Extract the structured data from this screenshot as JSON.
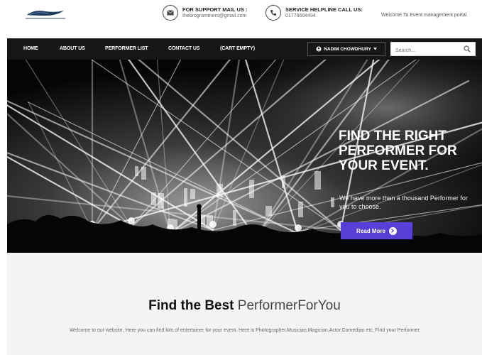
{
  "topbar": {
    "logo_icon": "brand-logo-icon",
    "support": {
      "icon": "mail-icon",
      "title": "FOR SUPPORT MAIL US :",
      "value": "thebrogrammers@gmail.com"
    },
    "helpline": {
      "icon": "phone-icon",
      "title": "SERVICE HELPLINE CALL US:",
      "value": "01776604494"
    },
    "welcome": "Welcome To Event management portal"
  },
  "nav": {
    "items": [
      {
        "label": "HOME"
      },
      {
        "label": "ABOUT US"
      },
      {
        "label": "PERFORMER LIST"
      },
      {
        "label": "CONTACT US"
      },
      {
        "label": "(CART EMPTY)"
      }
    ],
    "user": {
      "icon": "user-circle-icon",
      "label": "NADIM CHOWDHURY",
      "caret_icon": "caret-down-icon"
    },
    "search": {
      "placeholder": "Search...",
      "icon": "search-icon"
    }
  },
  "hero": {
    "title": "FIND THE RIGHT PERFORMER FOR YOUR EVENT.",
    "subtitle": "We have more than a thousand Performer for you to choose.",
    "button_label": "Read More",
    "button_icon": "arrow-right-circle-icon",
    "colors": {
      "button": "#5a3fd6"
    }
  },
  "section": {
    "heading_bold": "Find the Best",
    "heading_light": "PerformerForYou",
    "text": "Welcome to our website, Here you can find lots of entertainer for your event. Here is Photographer,Musician,Magician,Actor,Comedian etc. Find your Performer"
  }
}
